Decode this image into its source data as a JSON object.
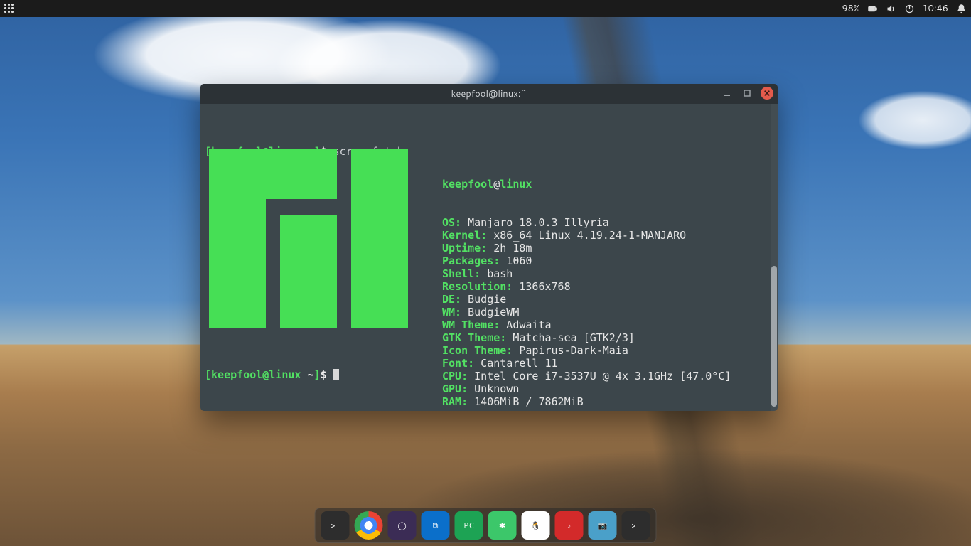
{
  "panel": {
    "battery": "98%",
    "clock": "10:46"
  },
  "terminal": {
    "title": "keepfool@linux:~",
    "prompt": {
      "open": "[",
      "user": "keepfool@linux",
      "path": " ~",
      "close": "]",
      "symbol": "$"
    },
    "command": "screenfetch",
    "userhost": {
      "user": "keepfool",
      "at": "@",
      "host": "linux"
    },
    "info": [
      {
        "k": "OS:",
        "v": " Manjaro 18.0.3 Illyria"
      },
      {
        "k": "Kernel:",
        "v": " x86_64 Linux 4.19.24-1-MANJARO"
      },
      {
        "k": "Uptime:",
        "v": " 2h 18m"
      },
      {
        "k": "Packages:",
        "v": " 1060"
      },
      {
        "k": "Shell:",
        "v": " bash"
      },
      {
        "k": "Resolution:",
        "v": " 1366x768"
      },
      {
        "k": "DE:",
        "v": " Budgie"
      },
      {
        "k": "WM:",
        "v": " BudgieWM"
      },
      {
        "k": "WM Theme:",
        "v": " Adwaita"
      },
      {
        "k": "GTK Theme:",
        "v": " Matcha-sea [GTK2/3]"
      },
      {
        "k": "Icon Theme:",
        "v": " Papirus-Dark-Maia"
      },
      {
        "k": "Font:",
        "v": " Cantarell 11"
      },
      {
        "k": "CPU:",
        "v": " Intel Core i7-3537U @ 4x 3.1GHz [47.0°C]"
      },
      {
        "k": "GPU:",
        "v": " Unknown"
      },
      {
        "k": "RAM:",
        "v": " 1406MiB / 7862MiB"
      }
    ]
  },
  "dock": {
    "items": [
      {
        "name": "terminal",
        "bg": "#2d2d2d",
        "label": ">_"
      },
      {
        "name": "chrome",
        "bg": "",
        "label": ""
      },
      {
        "name": "eclipse",
        "bg": "#3b2c55",
        "label": "◯"
      },
      {
        "name": "vscode",
        "bg": "#0b6fca",
        "label": "⧉"
      },
      {
        "name": "pycharm",
        "bg": "#1da354",
        "label": "PC"
      },
      {
        "name": "wechat",
        "bg": "#3cc76a",
        "label": "✱"
      },
      {
        "name": "qq",
        "bg": "#ffffff",
        "label": "🐧"
      },
      {
        "name": "netease-music",
        "bg": "#d32a2a",
        "label": "♪"
      },
      {
        "name": "screenshot",
        "bg": "#4aa0c9",
        "label": "📷"
      },
      {
        "name": "terminal-2",
        "bg": "#2d2d2d",
        "label": ">_"
      }
    ]
  }
}
